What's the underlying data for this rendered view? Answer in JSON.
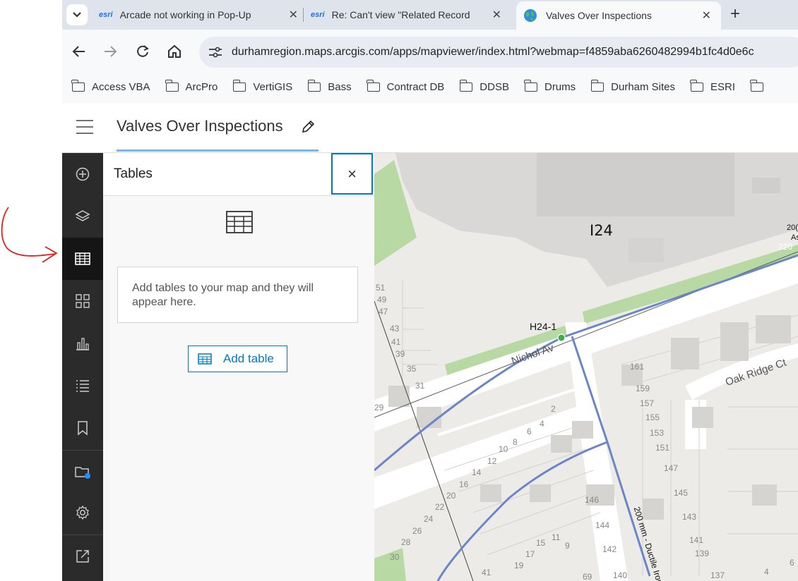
{
  "browser": {
    "tabs": [
      {
        "favicon": "esri",
        "title": "Arcade not working in Pop-Up"
      },
      {
        "favicon": "esri",
        "title": "Re: Can't view \"Related Record"
      },
      {
        "favicon": "globe-icon",
        "title": "Valves Over Inspections"
      }
    ],
    "new_tab": "+",
    "url": "durhamregion.maps.arcgis.com/apps/mapviewer/index.html?webmap=f4859aba6260482994b1fc4d0e6c",
    "bookmarks": [
      "Access VBA",
      "ArcPro",
      "VertiGIS",
      "Bass",
      "Contract DB",
      "DDSB",
      "Drums",
      "Durham Sites",
      "ESRI"
    ]
  },
  "app": {
    "title": "Valves Over Inspections"
  },
  "panel": {
    "title": "Tables",
    "close": "×",
    "message": "Add tables to your map and they will appear here.",
    "add_button": "Add table"
  },
  "map": {
    "labels": {
      "zone": "I24",
      "valve": "H24-1",
      "street1": "Nichol Av",
      "street2": "Oak Ridge Ct",
      "pipe": "200 mm - Ductile Iron",
      "corner_a": "20(",
      "corner_b": "As",
      "corner_c": "220"
    },
    "addresses_left": [
      "51",
      "49",
      "47",
      "43",
      "41",
      "39",
      "35",
      "31",
      "29"
    ],
    "addresses_mid": [
      "2",
      "4",
      "6",
      "8",
      "10",
      "12",
      "14",
      "16",
      "20",
      "22",
      "24",
      "26",
      "28",
      "30"
    ],
    "addresses_bottom": [
      "146",
      "144",
      "142",
      "140",
      "15",
      "17",
      "19",
      "11",
      "9",
      "69",
      "41"
    ],
    "addresses_right": [
      "161",
      "159",
      "157",
      "155",
      "153",
      "151",
      "147",
      "145",
      "143",
      "141",
      "139",
      "137",
      "4",
      "6"
    ]
  },
  "colors": {
    "accent": "#007ac2",
    "nav_bg": "#2b2b2b",
    "annotation": "#e0201b",
    "pipe": "#5b7fc4"
  }
}
